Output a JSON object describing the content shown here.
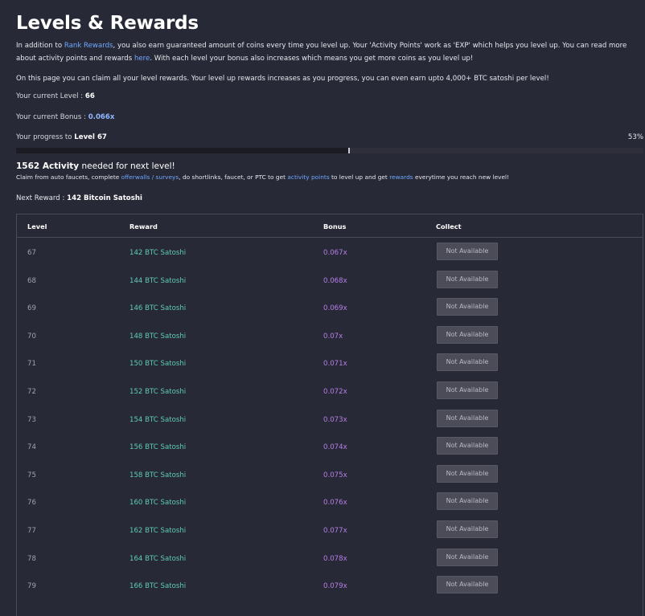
{
  "page": {
    "title": "Levels & Rewards",
    "intro": {
      "part1": "In addition to ",
      "rank_link": "Rank Rewards",
      "part2": ", you also earn guaranteed amount of coins every time you level up. Your 'Activity Points' work as 'EXP' which helps you level up. You can read more about activity points and rewards ",
      "here_link": "here",
      "part3": ". With each level your bonus also increases which means you get more coins as you level up!"
    },
    "claim_text": "On this page you can claim all your level rewards. Your level up rewards increases as you progress, you can even earn upto 4,000+ BTC satoshi per level!",
    "current_level_label": "Your current Level : ",
    "current_level": "66",
    "current_bonus_label": "Your current Bonus : ",
    "current_bonus": "0.066x",
    "progress_label": "Your progress to ",
    "progress_target": "Level 67",
    "progress_percent_text": "53%",
    "progress_fraction": 0.53,
    "activity_needed": "1562 Activity",
    "activity_needed_suffix": " needed for next level!",
    "claim_note": {
      "part1": "Claim from auto faucets, complete ",
      "offerwalls_link": "offerwalls / surveys",
      "part2": ", do shortlinks, faucet, or PTC to get ",
      "activity_link": "activity points",
      "part3": " to level up and get ",
      "rewards_link": "rewards",
      "part4": " everytime you reach new level!"
    },
    "next_reward_label": "Next Reward : ",
    "next_reward": "142 Bitcoin Satoshi"
  },
  "table": {
    "headers": {
      "level": "Level",
      "reward": "Reward",
      "bonus": "Bonus",
      "collect": "Collect"
    },
    "rows": [
      {
        "level": "67",
        "reward": "142 BTC Satoshi",
        "bonus": "0.067x",
        "action": "Not Available"
      },
      {
        "level": "68",
        "reward": "144 BTC Satoshi",
        "bonus": "0.068x",
        "action": "Not Available"
      },
      {
        "level": "69",
        "reward": "146 BTC Satoshi",
        "bonus": "0.069x",
        "action": "Not Available"
      },
      {
        "level": "70",
        "reward": "148 BTC Satoshi",
        "bonus": "0.07x",
        "action": "Not Available"
      },
      {
        "level": "71",
        "reward": "150 BTC Satoshi",
        "bonus": "0.071x",
        "action": "Not Available"
      },
      {
        "level": "72",
        "reward": "152 BTC Satoshi",
        "bonus": "0.072x",
        "action": "Not Available"
      },
      {
        "level": "73",
        "reward": "154 BTC Satoshi",
        "bonus": "0.073x",
        "action": "Not Available"
      },
      {
        "level": "74",
        "reward": "156 BTC Satoshi",
        "bonus": "0.074x",
        "action": "Not Available"
      },
      {
        "level": "75",
        "reward": "158 BTC Satoshi",
        "bonus": "0.075x",
        "action": "Not Available"
      },
      {
        "level": "76",
        "reward": "160 BTC Satoshi",
        "bonus": "0.076x",
        "action": "Not Available"
      },
      {
        "level": "77",
        "reward": "162 BTC Satoshi",
        "bonus": "0.077x",
        "action": "Not Available"
      },
      {
        "level": "78",
        "reward": "164 BTC Satoshi",
        "bonus": "0.078x",
        "action": "Not Available"
      },
      {
        "level": "79",
        "reward": "166 BTC Satoshi",
        "bonus": "0.079x",
        "action": "Not Available"
      }
    ]
  },
  "colors": {
    "background": "#282936",
    "link": "#6ea8ff",
    "reward": "#5ecbb8",
    "bonus": "#b77ee8"
  }
}
